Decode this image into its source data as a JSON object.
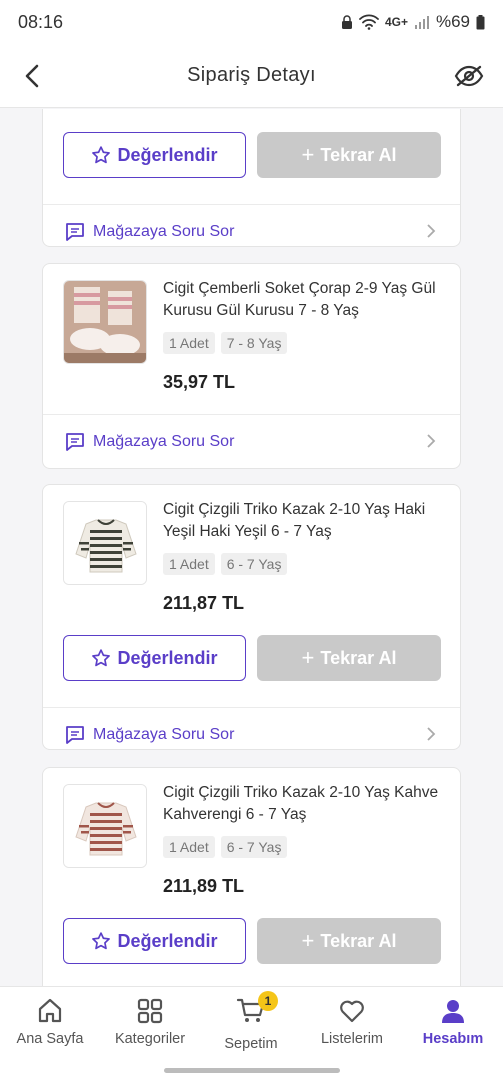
{
  "status": {
    "time": "08:16",
    "battery": "%69",
    "net": "4G+"
  },
  "header": {
    "title": "Sipariş Detayı"
  },
  "labels": {
    "rate": "Değerlendir",
    "rebuy": "Tekrar Al",
    "ask": "Mağazaya Soru Sor"
  },
  "items": [
    {
      "title": "Cigit Çemberli Soket Çorap 2-9 Yaş Gül Kurusu Gül Kurusu 7 - 8 Yaş",
      "qty": "1 Adet",
      "size": "7 - 8 Yaş",
      "price": "35,97 TL"
    },
    {
      "title": "Cigit Çizgili Triko Kazak 2-10 Yaş Haki Yeşil Haki Yeşil 6 - 7 Yaş",
      "qty": "1 Adet",
      "size": "6 - 7 Yaş",
      "price": "211,87 TL"
    },
    {
      "title": "Cigit Çizgili Triko Kazak 2-10 Yaş Kahve Kahverengi 6 - 7 Yaş",
      "qty": "1 Adet",
      "size": "6 - 7 Yaş",
      "price": "211,89 TL"
    }
  ],
  "nav": {
    "home": "Ana Sayfa",
    "categories": "Kategoriler",
    "cart": "Sepetim",
    "cart_badge": "1",
    "lists": "Listelerim",
    "account": "Hesabım"
  },
  "colors": {
    "accent": "#5a3ec8",
    "badge": "#f5c518",
    "disabled": "#c9c9c9"
  }
}
